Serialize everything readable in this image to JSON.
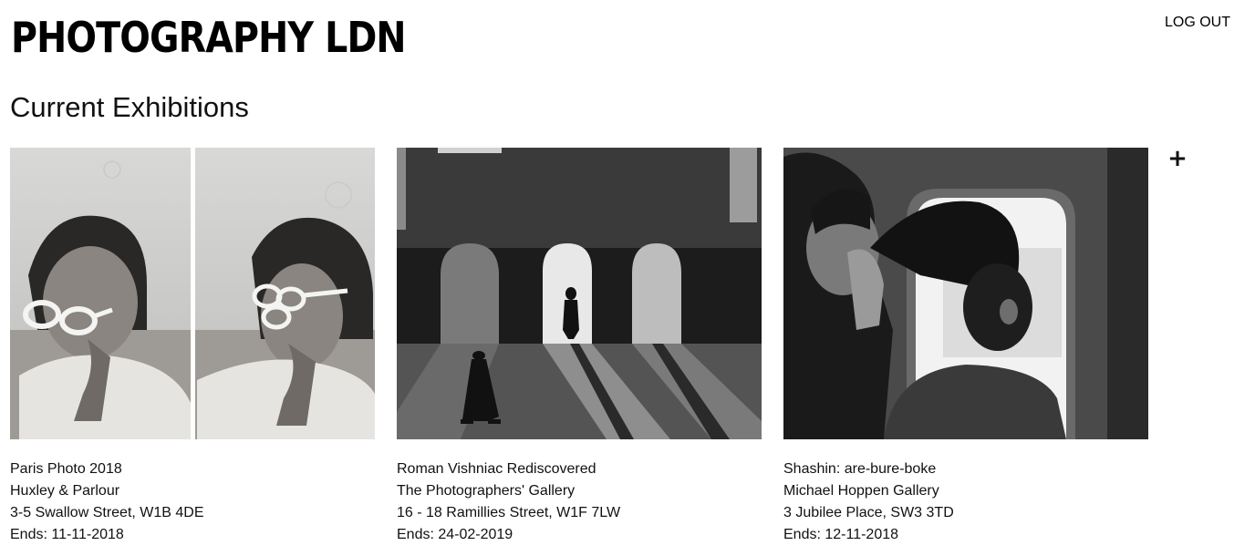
{
  "header": {
    "brand": "PHOTOGRAPHY LDN",
    "logout_label": "LOG OUT"
  },
  "page": {
    "title": "Current Exhibitions",
    "add_icon": "+"
  },
  "exhibitions": [
    {
      "name": "Paris Photo 2018",
      "gallery": "Huxley & Parlour",
      "address": "3-5 Swallow Street, W1B 4DE",
      "ends": "Ends: 11-11-2018",
      "image_icon": "diptych-portrait-sunglasses-photo"
    },
    {
      "name": "Roman Vishniac Rediscovered",
      "gallery": "The Photographers' Gallery",
      "address": "16 - 18 Ramillies Street, W1F 7LW",
      "ends": "Ends: 24-02-2019",
      "image_icon": "arched-hall-silhouettes-photo"
    },
    {
      "name": "Shashin: are-bure-boke",
      "gallery": "Michael Hoppen Gallery",
      "address": "3 Jubilee Place, SW3 3TD",
      "ends": "Ends: 12-11-2018",
      "image_icon": "train-window-figures-photo"
    }
  ]
}
